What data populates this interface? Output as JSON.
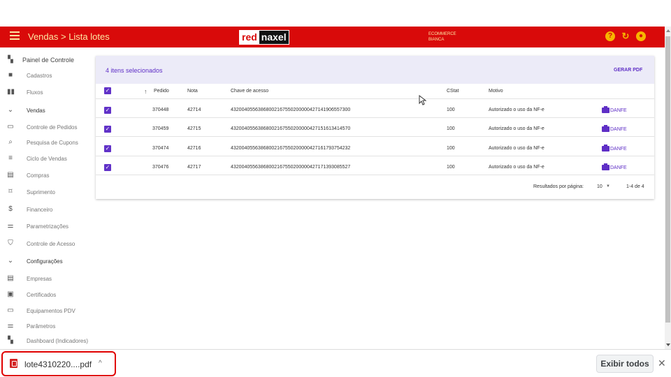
{
  "header": {
    "breadcrumb": "Vendas > Lista lotes",
    "logo_red": "red",
    "logo_dark": "naxel",
    "store_line1": "ECOMMERCE",
    "store_line2": "BIANCA",
    "icons": [
      "help-icon",
      "refresh-icon",
      "user-icon"
    ],
    "colors": {
      "bar": "#d90a0a",
      "text": "#fde7a3",
      "accent": "#6132c8"
    }
  },
  "sidebar": {
    "items": [
      {
        "label": "Painel de Controle",
        "icon": "dashboard-icon",
        "kind": "main"
      },
      {
        "label": "Cadastros",
        "icon": "folder-icon",
        "kind": "item"
      },
      {
        "label": "Fluxos",
        "icon": "columns-icon",
        "kind": "item"
      },
      {
        "label": "Vendas",
        "icon": "chevron-down-icon",
        "kind": "group"
      },
      {
        "label": "Controle de Pedidos",
        "icon": "register-icon",
        "kind": "item"
      },
      {
        "label": "Pesquisa de Cupons",
        "icon": "search-icon",
        "kind": "item"
      },
      {
        "label": "Ciclo de Vendas",
        "icon": "list-icon",
        "kind": "item"
      },
      {
        "label": "Compras",
        "icon": "building-icon",
        "kind": "item"
      },
      {
        "label": "Suprimento",
        "icon": "box-icon",
        "kind": "item"
      },
      {
        "label": "Financeiro",
        "icon": "dollar-icon",
        "kind": "item"
      },
      {
        "label": "Parametrizações",
        "icon": "sliders-icon",
        "kind": "item"
      },
      {
        "label": "Controle de Acesso",
        "icon": "shield-icon",
        "kind": "item"
      },
      {
        "label": "Configurações",
        "icon": "chevron-down-icon",
        "kind": "group"
      },
      {
        "label": "Empresas",
        "icon": "building-icon",
        "kind": "item"
      },
      {
        "label": "Certificados",
        "icon": "certificate-icon",
        "kind": "item"
      },
      {
        "label": "Equipamentos PDV",
        "icon": "monitor-icon",
        "kind": "item"
      },
      {
        "label": "Parâmetros",
        "icon": "sliders-icon",
        "kind": "item"
      },
      {
        "label": "Dashboard (Indicadores)",
        "icon": "dashboard-icon",
        "kind": "item"
      }
    ]
  },
  "main": {
    "selected_text": "4 itens selecionados",
    "generate_pdf": "GERAR PDF",
    "columns": [
      "Pedido",
      "Nota",
      "Chave de acesso",
      "CStat",
      "Motivo"
    ],
    "sort_icon": "arrow-up-icon",
    "rows": [
      {
        "pedido": "370448",
        "nota": "42714",
        "chave": "43200405563868002167550200000427141906557300",
        "cstat": "100",
        "motivo": "Autorizado o uso da NF-e",
        "danfe": "DANFE",
        "checked": true
      },
      {
        "pedido": "370459",
        "nota": "42715",
        "chave": "43200405563868002167550200000427151613414570",
        "cstat": "100",
        "motivo": "Autorizado o uso da NF-e",
        "danfe": "DANFE",
        "checked": true
      },
      {
        "pedido": "370474",
        "nota": "42716",
        "chave": "43200405563868002167550200000427161793754232",
        "cstat": "100",
        "motivo": "Autorizado o uso da NF-e",
        "danfe": "DANFE",
        "checked": true
      },
      {
        "pedido": "370476",
        "nota": "42717",
        "chave": "43200405563868002167550200000427171393085527",
        "cstat": "100",
        "motivo": "Autorizado o uso da NF-e",
        "danfe": "DANFE",
        "checked": true
      }
    ],
    "footer": {
      "per_page_label": "Resultados por página:",
      "per_page_value": "10",
      "range": "1-4 de 4"
    }
  },
  "downloads": {
    "file_name": "lote4310220....pdf",
    "show_all": "Exibir todos",
    "close": "✕"
  }
}
